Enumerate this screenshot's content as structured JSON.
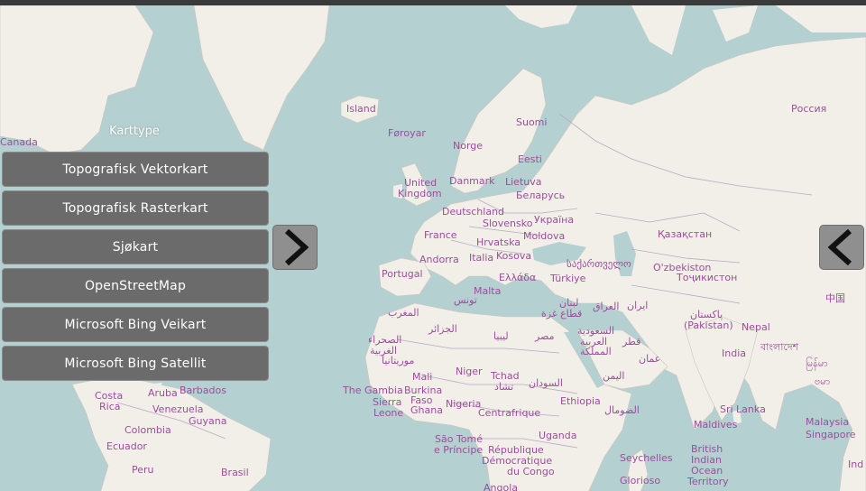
{
  "panel": {
    "title": "Karttype",
    "items": [
      {
        "label": "Topografisk Vektorkart"
      },
      {
        "label": "Topografisk Rasterkart"
      },
      {
        "label": "Sjøkart"
      },
      {
        "label": "OpenStreetMap"
      },
      {
        "label": "Microsoft Bing Veikart"
      },
      {
        "label": "Microsoft Bing Satellit"
      }
    ]
  },
  "map_labels": {
    "canada": "Canada",
    "island": "Island",
    "foroyar": "Føroyar",
    "suomi": "Suomi",
    "norge": "Norge",
    "eesti": "Eesti",
    "rossiya": "Россия",
    "united_kingdom_1": "United",
    "united_kingdom_2": "Kingdom",
    "danmark": "Danmark",
    "lietuva": "Lietuva",
    "belarus": "Беларусь",
    "deutschland": "Deutschland",
    "slovensko": "Slovensko",
    "ukraina": "Україна",
    "france": "France",
    "hrvatska": "Hrvatska",
    "moldova": "Moldova",
    "qazaqstan": "Қазақстан",
    "andorra": "Andorra",
    "kosova": "Kosova",
    "portugal": "Portugal",
    "italia": "Italia",
    "sakartvelo": "საქართველო",
    "uzbekiston": "O'zbekiston",
    "ellada": "Ελλάδα",
    "turkiye": "Türkiye",
    "tojikiston": "Тоҷикистон",
    "malta": "Malta",
    "tunis": "تونس",
    "china": "中国",
    "maghrib": "المغرب",
    "lubnan": "لبنان",
    "iraq": "العراق",
    "iran": "ایران",
    "gaza": "قطاع غزة",
    "pakistan_1": "پاکستان",
    "pakistan_2": "(Pakistan)",
    "nepal": "Nepal",
    "jazair": "الجزائر",
    "libya": "ليبيا",
    "misr": "مصر",
    "saudia_1": "السعودية",
    "saudia_2": "العربية",
    "saudia_3": "المملكة",
    "qatar": "قطر",
    "india": "India",
    "bangladesh": "বাংলাদেশ",
    "sahra_1": "الصحراء",
    "sahra_2": "الغربية",
    "oman": "عمان",
    "mauritania": "موريتانيا",
    "mali": "Mali",
    "niger": "Niger",
    "tchad": "Tchad",
    "tchad_ar": "تشاد",
    "sudan": "السودان",
    "yemen": "اليمن",
    "myanmar_1": "မြန်မာ",
    "myanmar_2": "ဗမာ",
    "gambia": "The Gambia",
    "burkina": "Burkina",
    "faso": "Faso",
    "sierra": "Sierra",
    "leone": "Leone",
    "ghana": "Ghana",
    "nigeria": "Nigeria",
    "ethiopia": "Ethiopia",
    "somalia": "الصومال",
    "centrafrique": "Centrafrique",
    "sri_lanka": "Sri Lanka",
    "malaysia": "Malaysia",
    "singapore": "Singapore",
    "maldives": "Maldives",
    "aruba": "Aruba",
    "barbados": "Barbados",
    "costa": "Costa",
    "rica": "Rica",
    "venezuela": "Venezuela",
    "guyana": "Guyana",
    "colombia": "Colombia",
    "ecuador": "Ecuador",
    "peru": "Peru",
    "brasil": "Brasil",
    "uganda": "Uganda",
    "sao_tome_1": "São Tomé",
    "sao_tome_2": "e Príncipe",
    "rdc_1": "République",
    "rdc_2": "Démocratique",
    "rdc_3": "du Congo",
    "seychelles": "Seychelles",
    "biot_1": "British",
    "biot_2": "Indian",
    "biot_3": "Ocean",
    "biot_4": "Territory",
    "glorioso": "Glorioso",
    "angola": "Angola",
    "ind": "Ind"
  },
  "colors": {
    "ocean": "#b5d0d0",
    "land": "#f2efe9",
    "border": "#b9a9c4",
    "label": "#9b4d9b",
    "button": "#6b6b6b"
  },
  "icons": {
    "forward": "chevron-right-icon",
    "back": "chevron-left-icon"
  }
}
